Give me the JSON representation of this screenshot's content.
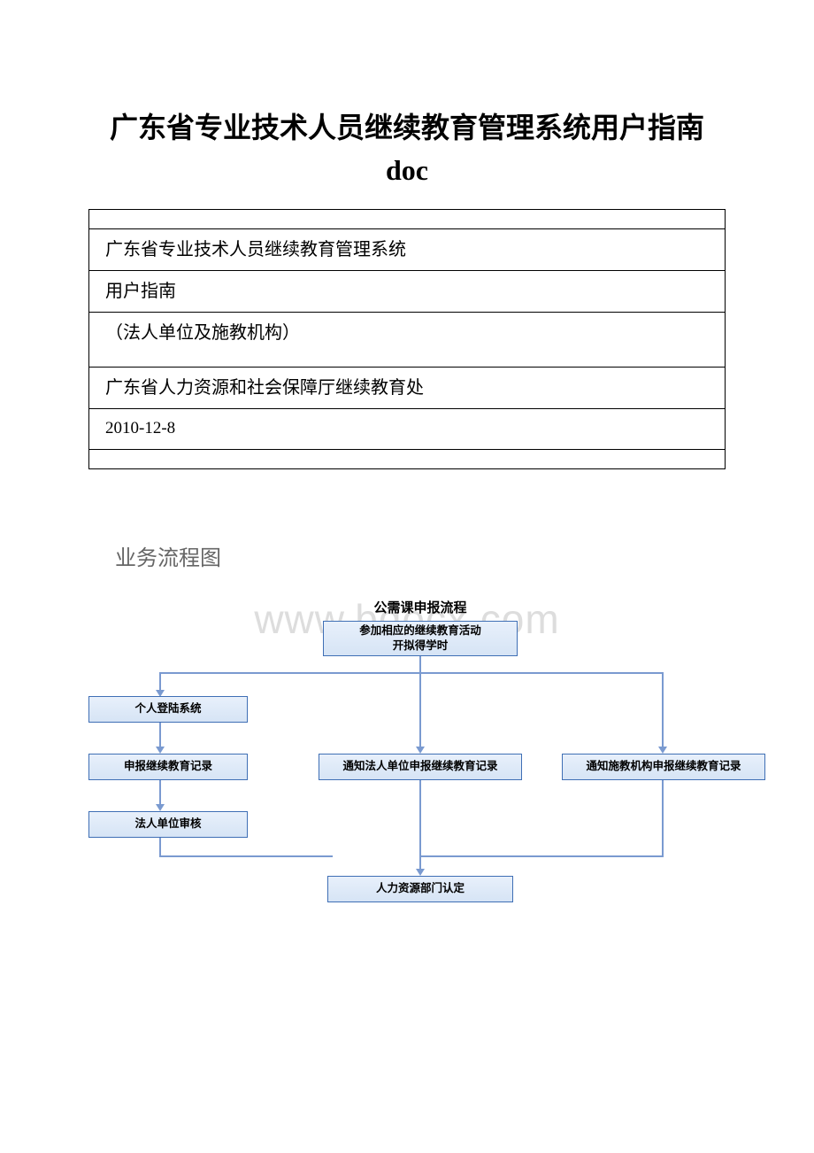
{
  "title": "广东省专业技术人员继续教育管理系统用户指南 doc",
  "meta": {
    "r1": "广东省专业技术人员继续教育管理系统",
    "r2": "用户指南",
    "r3": "（法人单位及施教机构）",
    "r4": "广东省人力资源和社会保障厅继续教育处",
    "r5": "2010-12-8"
  },
  "section_heading": "业务流程图",
  "watermark": "www.bdocx.com",
  "flow": {
    "title": "公需课申报流程",
    "top": "参加相应的继续教育活动\n开拟得学时",
    "n1": "个人登陆系统",
    "n2a": "申报继续教育记录",
    "n2b": "通知法人单位申报继续教育记录",
    "n2c": "通知施教机构申报继续教育记录",
    "n3": "法人单位审核",
    "n4": "人力资源部门认定"
  }
}
